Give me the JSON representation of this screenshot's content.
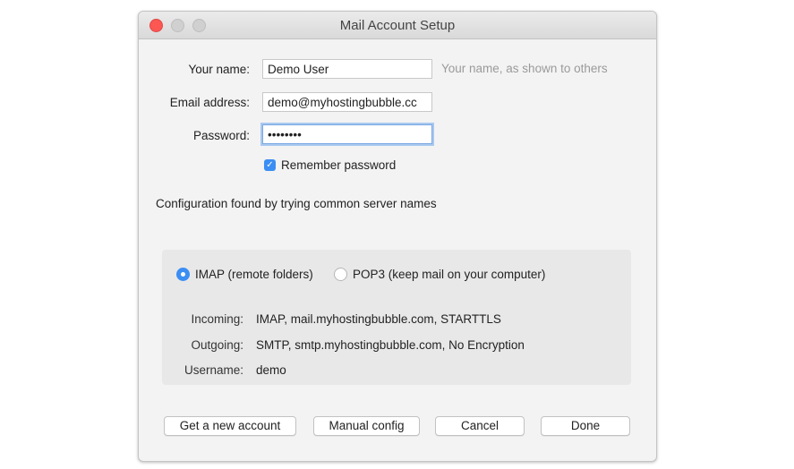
{
  "window": {
    "title": "Mail Account Setup",
    "controls": [
      "close",
      "minimize",
      "maximize"
    ]
  },
  "form": {
    "name": {
      "label": "Your name:",
      "value": "Demo User",
      "hint": "Your name, as shown to others"
    },
    "email": {
      "label": "Email address:",
      "value": "demo@myhostingbubble.cc"
    },
    "password": {
      "label": "Password:",
      "value": "••••••••"
    },
    "remember": {
      "label": "Remember password",
      "checked": true
    }
  },
  "status_text": "Configuration found by trying common server names",
  "protocol": {
    "options": [
      {
        "label": "IMAP (remote folders)",
        "selected": true
      },
      {
        "label": "POP3 (keep mail on your computer)",
        "selected": false
      }
    ]
  },
  "details": [
    {
      "key": "Incoming:",
      "value": "IMAP, mail.myhostingbubble.com, STARTTLS"
    },
    {
      "key": "Outgoing:",
      "value": "SMTP, smtp.myhostingbubble.com, No Encryption"
    },
    {
      "key": "Username:",
      "value": "demo"
    }
  ],
  "buttons": {
    "new_account": "Get a new account",
    "manual_config": "Manual config",
    "cancel": "Cancel",
    "done": "Done"
  },
  "colors": {
    "accent": "#3b8ef3",
    "close": "#fc5753"
  }
}
